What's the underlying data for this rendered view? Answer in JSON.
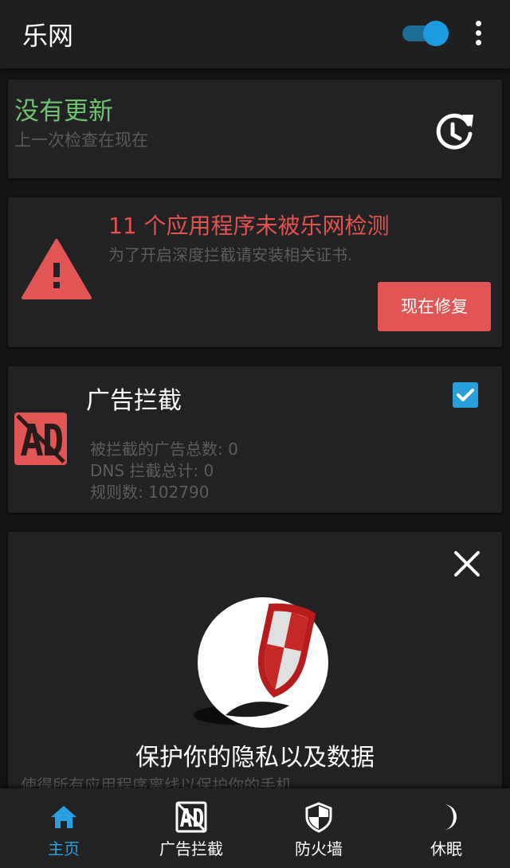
{
  "appbar": {
    "title": "乐网",
    "toggle_on": true
  },
  "update_card": {
    "title": "没有更新",
    "subtitle": "上一次检查在现在",
    "icon": "refresh-clock-icon"
  },
  "warning_card": {
    "title": "11 个应用程序未被乐网检测",
    "subtitle": "为了开启深度拦截请安装相关证书.",
    "button": "现在修复",
    "icon": "warning-icon"
  },
  "adblock_card": {
    "title": "广告拦截",
    "checked": true,
    "stats": [
      "被拦截的广告总数: 0",
      "DNS 拦截总计: 0",
      "规则数: 102790"
    ],
    "icon": "ad-block-icon"
  },
  "promo_card": {
    "title": "保护你的隐私以及数据",
    "subtitle": "使得所有应用程序离线以保护你的手机",
    "icon": "shield-icon"
  },
  "bottom_nav": {
    "items": [
      {
        "label": "主页",
        "icon": "home-icon",
        "active": true
      },
      {
        "label": "广告拦截",
        "icon": "ad-block-icon",
        "active": false
      },
      {
        "label": "防火墙",
        "icon": "shield-icon",
        "active": false
      },
      {
        "label": "休眠",
        "icon": "moon-icon",
        "active": false
      }
    ]
  },
  "colors": {
    "accent": "#2a9fe0",
    "success": "#6fc36f",
    "danger": "#e25555",
    "background": "#141414",
    "card": "#222224"
  }
}
